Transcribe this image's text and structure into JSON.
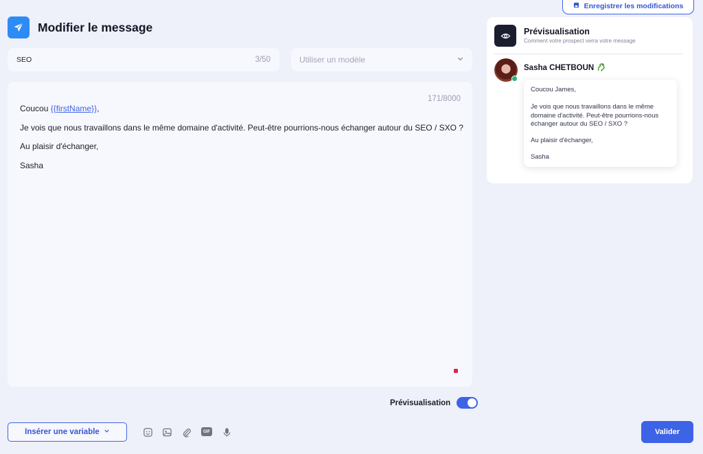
{
  "toolbar": {
    "save_label": "Enregistrer les modifications"
  },
  "header": {
    "title": "Modifier le message",
    "logo_icon": "paper-plane-icon",
    "logo_color": "#2d8bf6"
  },
  "subject": {
    "value": "SEO",
    "counter": "3/50"
  },
  "template": {
    "placeholder": "Utiliser un modèle"
  },
  "editor": {
    "counter": "171/8000",
    "greeting_prefix": "Coucou ",
    "variable": "{{firstName}}",
    "greeting_suffix": ",",
    "line2": "Je vois que nous travaillons dans le même domaine d'activité. Peut-être pourrions-nous échanger autour du SEO / SXO ?",
    "line3": "Au plaisir d'échanger,",
    "line4": "Sasha"
  },
  "preview_toggle": {
    "label": "Prévisualisation",
    "on": true
  },
  "bottom": {
    "insert_label": "Insérer une variable",
    "validate_label": "Valider",
    "gif_label": "GIF",
    "icons": [
      "emoji-icon",
      "image-icon",
      "attachment-icon",
      "gif-icon",
      "microphone-icon"
    ]
  },
  "preview": {
    "title": "Prévisualisation",
    "subtitle": "Comment votre prospect verra votre message",
    "name": "Sasha CHETBOUN",
    "bubble": {
      "l1": "Coucou James,",
      "l2": "Je vois que nous travaillons dans le même domaine d'activité. Peut-être pourrions-nous échanger autour du SEO / SXO ?",
      "l3": "Au plaisir d'échanger,",
      "l4": "Sasha"
    }
  },
  "colors": {
    "accent": "#3d63e6",
    "background": "#eef0fa",
    "online": "#22b573"
  }
}
